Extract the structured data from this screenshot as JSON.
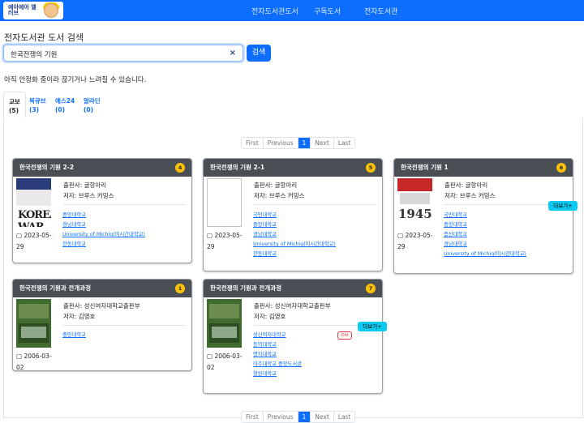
{
  "nav": {
    "logo_text": "예아에아 엘러브",
    "links": [
      "전자도서관도서",
      "구독도서",
      "전자도서관"
    ]
  },
  "page_title": "전자도서관 도서 검색",
  "search": {
    "value": "한국전쟁의 기원",
    "clear": "×",
    "button": "검색"
  },
  "notice": "아직 안정화 중이라 끊기거나 느려질 수 있습니다.",
  "tabs": [
    {
      "name": "교보",
      "count": "(5)",
      "active": true
    },
    {
      "name": "북큐브",
      "count": "(3)",
      "active": false
    },
    {
      "name": "예스24",
      "count": "(0)",
      "active": false
    },
    {
      "name": "알라딘",
      "count": "(0)",
      "active": false
    }
  ],
  "pagination": [
    "First",
    "Previous",
    "1",
    "Next",
    "Last"
  ],
  "pagination_active": "1",
  "more_label": "더보기+",
  "old_label": "Old",
  "cards": [
    {
      "title": "한국전쟁의 기원 2-2",
      "badge": "4",
      "publisher": "출판사: 글항아리",
      "author": "저자: 브루스 커밍스",
      "date": "2023-05-29",
      "libraries": [
        "중앙대학교",
        "경남대학교",
        "University of Michig(미시간대학교)",
        "한동대학교"
      ],
      "cover_text": "KOREAN WAR"
    },
    {
      "title": "한국전쟁의 기원 2-1",
      "badge": "5",
      "publisher": "출판사: 글항아리",
      "author": "저자: 브루스 커밍스",
      "date": "2023-05-29",
      "libraries": [
        "국민대학교",
        "중앙대학교",
        "경남대학교",
        "University of Michig(미시간대학교)",
        "한동대학교"
      ]
    },
    {
      "title": "한국전쟁의 기원 1",
      "badge": "6",
      "publisher": "출판사: 글항아리",
      "author": "저자: 브루스 커밍스",
      "date": "2023-05-29",
      "libraries": [
        "국민대학교",
        "중앙대학교",
        "충신대학교",
        "경남대학교",
        "University of Michig(미시간대학교)"
      ],
      "cover_text": "1945"
    },
    {
      "title": "한국전쟁의 기원과 전개과정",
      "badge": "1",
      "publisher": "출판사: 성신여자대학교출판부",
      "author": "저자: 김영호",
      "date": "2006-03-02",
      "libraries": [
        "중앙대학교"
      ]
    },
    {
      "title": "한국전쟁의 기원과 전개과정",
      "badge": "7",
      "publisher": "출판사: 성신여자대학교출판부",
      "author": "저자: 김영호",
      "date": "2006-03-02",
      "libraries": [
        "성신여자대학교",
        "동의대학교",
        "명지대학교",
        "아주대학교 중앙도서관",
        "창원대학교"
      ]
    }
  ],
  "colors": {
    "primary": "#0d6efd",
    "card_header": "#4a4f55",
    "badge": "#ffc107",
    "more_button": "#0dcaf0",
    "old_tag": "#dc3545"
  }
}
